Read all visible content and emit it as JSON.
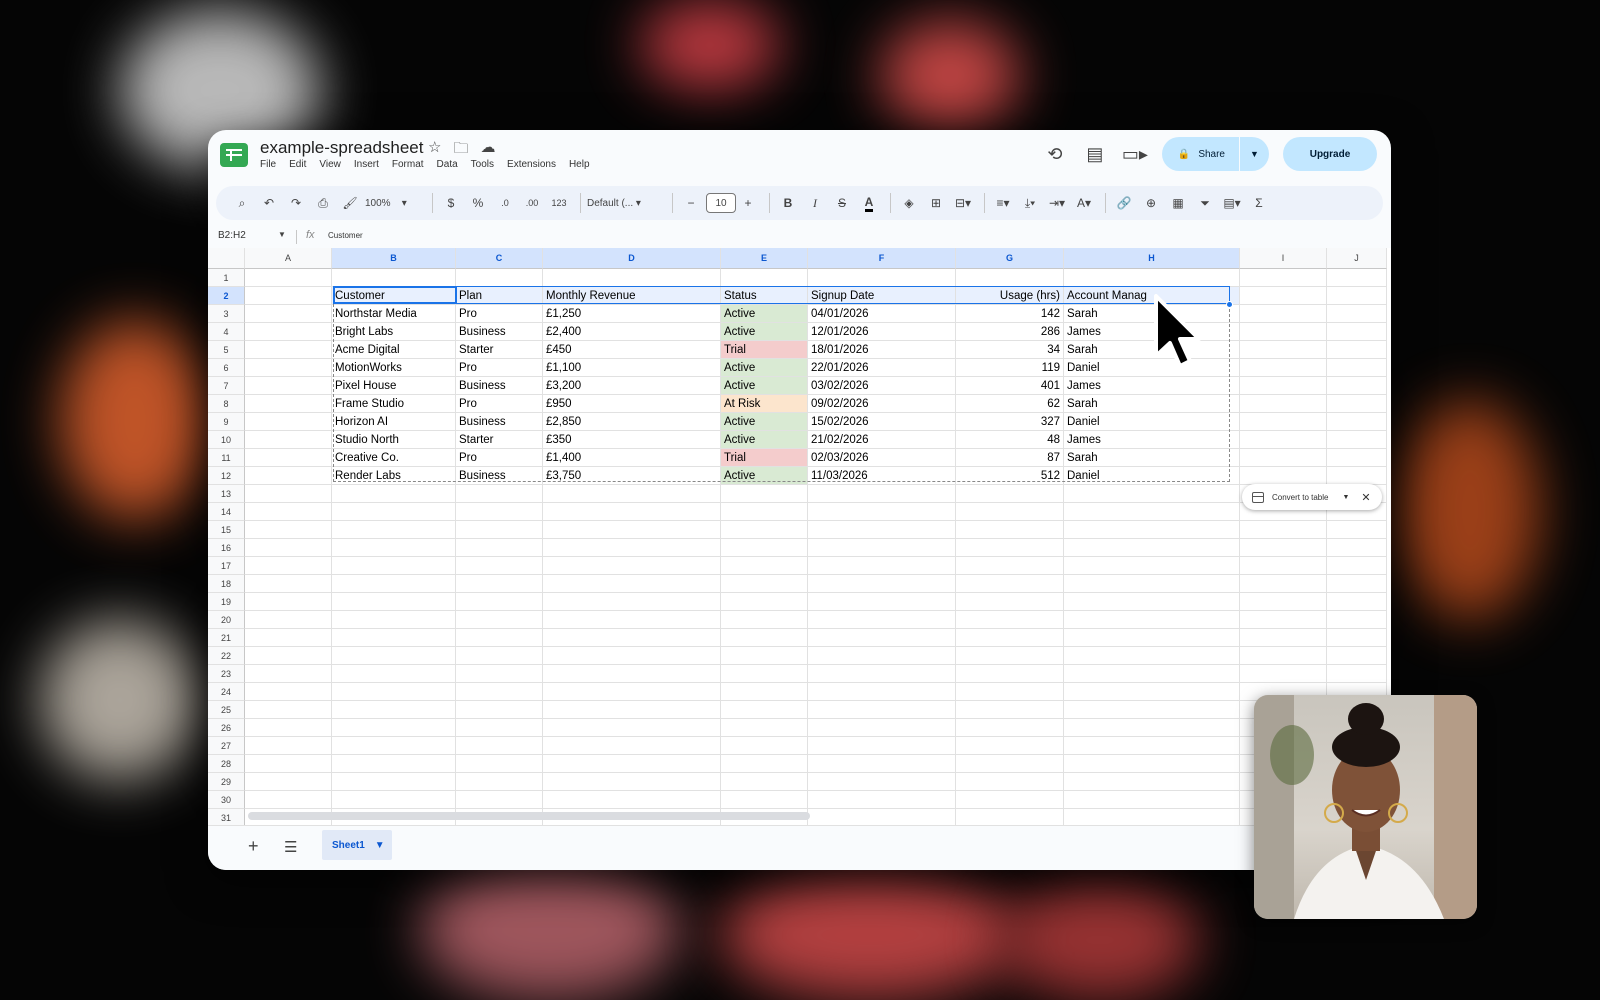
{
  "app": {
    "title": "example-spreadsheet",
    "menu": [
      "File",
      "Edit",
      "View",
      "Insert",
      "Format",
      "Data",
      "Tools",
      "Extensions",
      "Help"
    ],
    "share_label": "Share",
    "upgrade_label": "Upgrade"
  },
  "toolbar": {
    "zoom": "100%",
    "currency": "$",
    "percent": "%",
    "decrease_decimal": ".0",
    "increase_decimal": ".00",
    "format_123": "123",
    "font": "Default (...",
    "font_size": "10",
    "bold": "B",
    "italic": "I",
    "strike": "S",
    "text_color": "A",
    "sum": "Σ"
  },
  "formula_bar": {
    "name_box": "B2:H2",
    "fx": "fx",
    "value": "Customer"
  },
  "columns": [
    "A",
    "B",
    "C",
    "D",
    "E",
    "F",
    "G",
    "H",
    "I",
    "J"
  ],
  "rows": [
    "1",
    "2",
    "3",
    "4",
    "5",
    "6",
    "7",
    "8",
    "9",
    "10",
    "11",
    "12",
    "13",
    "14",
    "15",
    "16",
    "17",
    "18",
    "19",
    "20",
    "21",
    "22",
    "23",
    "24",
    "25",
    "26",
    "27",
    "28",
    "29",
    "30",
    "31"
  ],
  "table": {
    "headers": [
      "Customer",
      "Plan",
      "Monthly Revenue",
      "Status",
      "Signup Date",
      "Usage (hrs)",
      "Account Manag"
    ],
    "rows": [
      [
        "Northstar Media",
        "Pro",
        "£1,250",
        "Active",
        "04/01/2026",
        "142",
        "Sarah"
      ],
      [
        "Bright Labs",
        "Business",
        "£2,400",
        "Active",
        "12/01/2026",
        "286",
        "James"
      ],
      [
        "Acme Digital",
        "Starter",
        "£450",
        "Trial",
        "18/01/2026",
        "34",
        "Sarah"
      ],
      [
        "MotionWorks",
        "Pro",
        "£1,100",
        "Active",
        "22/01/2026",
        "119",
        "Daniel"
      ],
      [
        "Pixel House",
        "Business",
        "£3,200",
        "Active",
        "03/02/2026",
        "401",
        "James"
      ],
      [
        "Frame Studio",
        "Pro",
        "£950",
        "At Risk",
        "09/02/2026",
        "62",
        "Sarah"
      ],
      [
        "Horizon AI",
        "Business",
        "£2,850",
        "Active",
        "15/02/2026",
        "327",
        "Daniel"
      ],
      [
        "Studio North",
        "Starter",
        "£350",
        "Active",
        "21/02/2026",
        "48",
        "James"
      ],
      [
        "Creative Co.",
        "Pro",
        "£1,400",
        "Trial",
        "02/03/2026",
        "87",
        "Sarah"
      ],
      [
        "Render Labs",
        "Business",
        "£3,750",
        "Active",
        "11/03/2026",
        "512",
        "Daniel"
      ]
    ]
  },
  "convert_popup": {
    "label": "Convert to table"
  },
  "sheets": {
    "active": "Sheet1"
  },
  "colors": {
    "active": "#d9ead3",
    "trial": "#f4cccc",
    "at_risk": "#fce5cd",
    "selection": "#1a73e8",
    "button_bg": "#c2e7ff"
  }
}
